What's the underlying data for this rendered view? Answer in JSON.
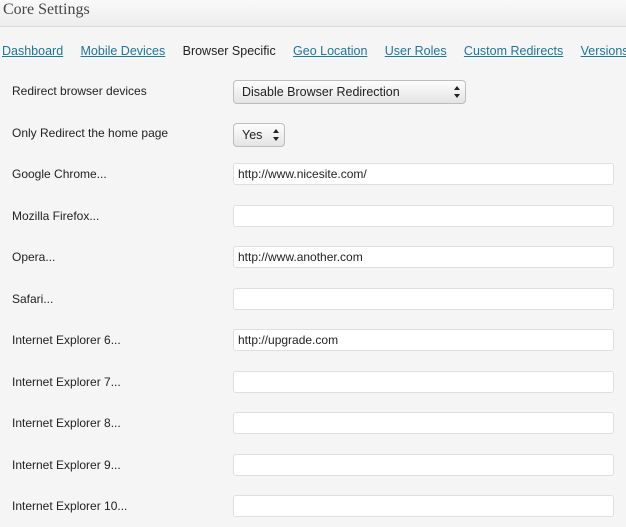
{
  "header": {
    "title": "Core Settings"
  },
  "tabs": [
    {
      "label": "Dashboard"
    },
    {
      "label": "Mobile Devices"
    },
    {
      "label": "Browser Specific"
    },
    {
      "label": "Geo Location"
    },
    {
      "label": "User Roles"
    },
    {
      "label": "Custom Redirects"
    },
    {
      "label": "Versions"
    }
  ],
  "active_tab": "Browser Specific",
  "settings": {
    "redirect_browser_devices": {
      "label": "Redirect browser devices",
      "value": "Disable Browser Redirection"
    },
    "only_redirect_home": {
      "label": "Only Redirect the home page",
      "value": "Yes"
    }
  },
  "browsers": [
    {
      "label": "Google Chrome...",
      "value": "http://www.nicesite.com/"
    },
    {
      "label": "Mozilla Firefox...",
      "value": ""
    },
    {
      "label": "Opera...",
      "value": "http://www.another.com"
    },
    {
      "label": "Safari...",
      "value": ""
    },
    {
      "label": "Internet Explorer 6...",
      "value": "http://upgrade.com"
    },
    {
      "label": "Internet Explorer 7...",
      "value": ""
    },
    {
      "label": "Internet Explorer 8...",
      "value": ""
    },
    {
      "label": "Internet Explorer 9...",
      "value": ""
    },
    {
      "label": "Internet Explorer 10...",
      "value": ""
    }
  ]
}
